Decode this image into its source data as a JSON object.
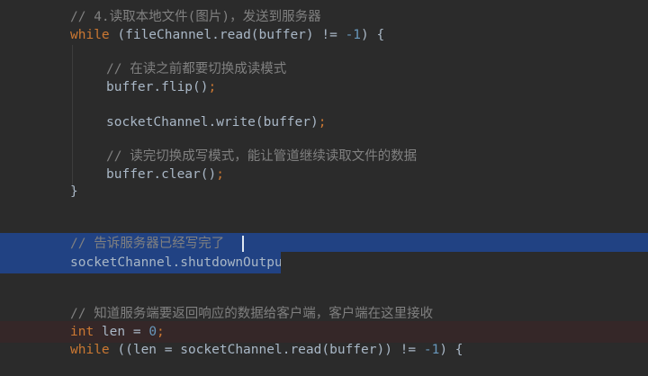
{
  "editor": {
    "lines": [
      {
        "indent": 1,
        "comment": "// 4.读取本地文件(图片)，发送到服务器"
      },
      {
        "indent": 1,
        "kw": "while",
        "before": " (fileChannel.",
        "method": "read",
        "after": "(buffer) != ",
        "num": "-1",
        "tail": ") {"
      },
      {
        "indent": 2,
        "comment": "// 在读之前都要切换成读模式"
      },
      {
        "indent": 2,
        "obj": "buffer.",
        "method": "flip",
        "args": "()",
        "semi": ";"
      },
      {
        "indent": 2,
        "obj": "socketChannel.",
        "method": "write",
        "args": "(buffer)",
        "semi": ";"
      },
      {
        "indent": 2,
        "comment": "// 读完切换成写模式，能让管道继续读取文件的数据"
      },
      {
        "indent": 2,
        "obj": "buffer.",
        "method": "clear",
        "args": "()",
        "semi": ";"
      },
      {
        "indent": 1,
        "text": "}"
      },
      {
        "indent": 1,
        "comment": "// 告诉服务器已经写完了"
      },
      {
        "indent": 1,
        "obj": "socketChannel.",
        "method": "shutdownOutput",
        "args": "()",
        "semi": ";"
      },
      {
        "indent": 1,
        "comment": "// 知道服务端要返回响应的数据给客户端，客户端在这里接收"
      },
      {
        "indent": 1,
        "kw": "int",
        "before": " len = ",
        "num": "0",
        "tail": "",
        "semi": ";"
      },
      {
        "indent": 1,
        "kw": "while",
        "before": " ((len = socketChannel.",
        "method": "read",
        "after": "(buffer)) != ",
        "num": "-1",
        "tail": ") {"
      }
    ]
  },
  "colors": {
    "background": "#2b2b2b",
    "comment": "#808080",
    "keyword": "#cc7832",
    "number": "#6897bb",
    "plain": "#a9b7c6",
    "selection": "#214283",
    "error_line": "#352728"
  }
}
